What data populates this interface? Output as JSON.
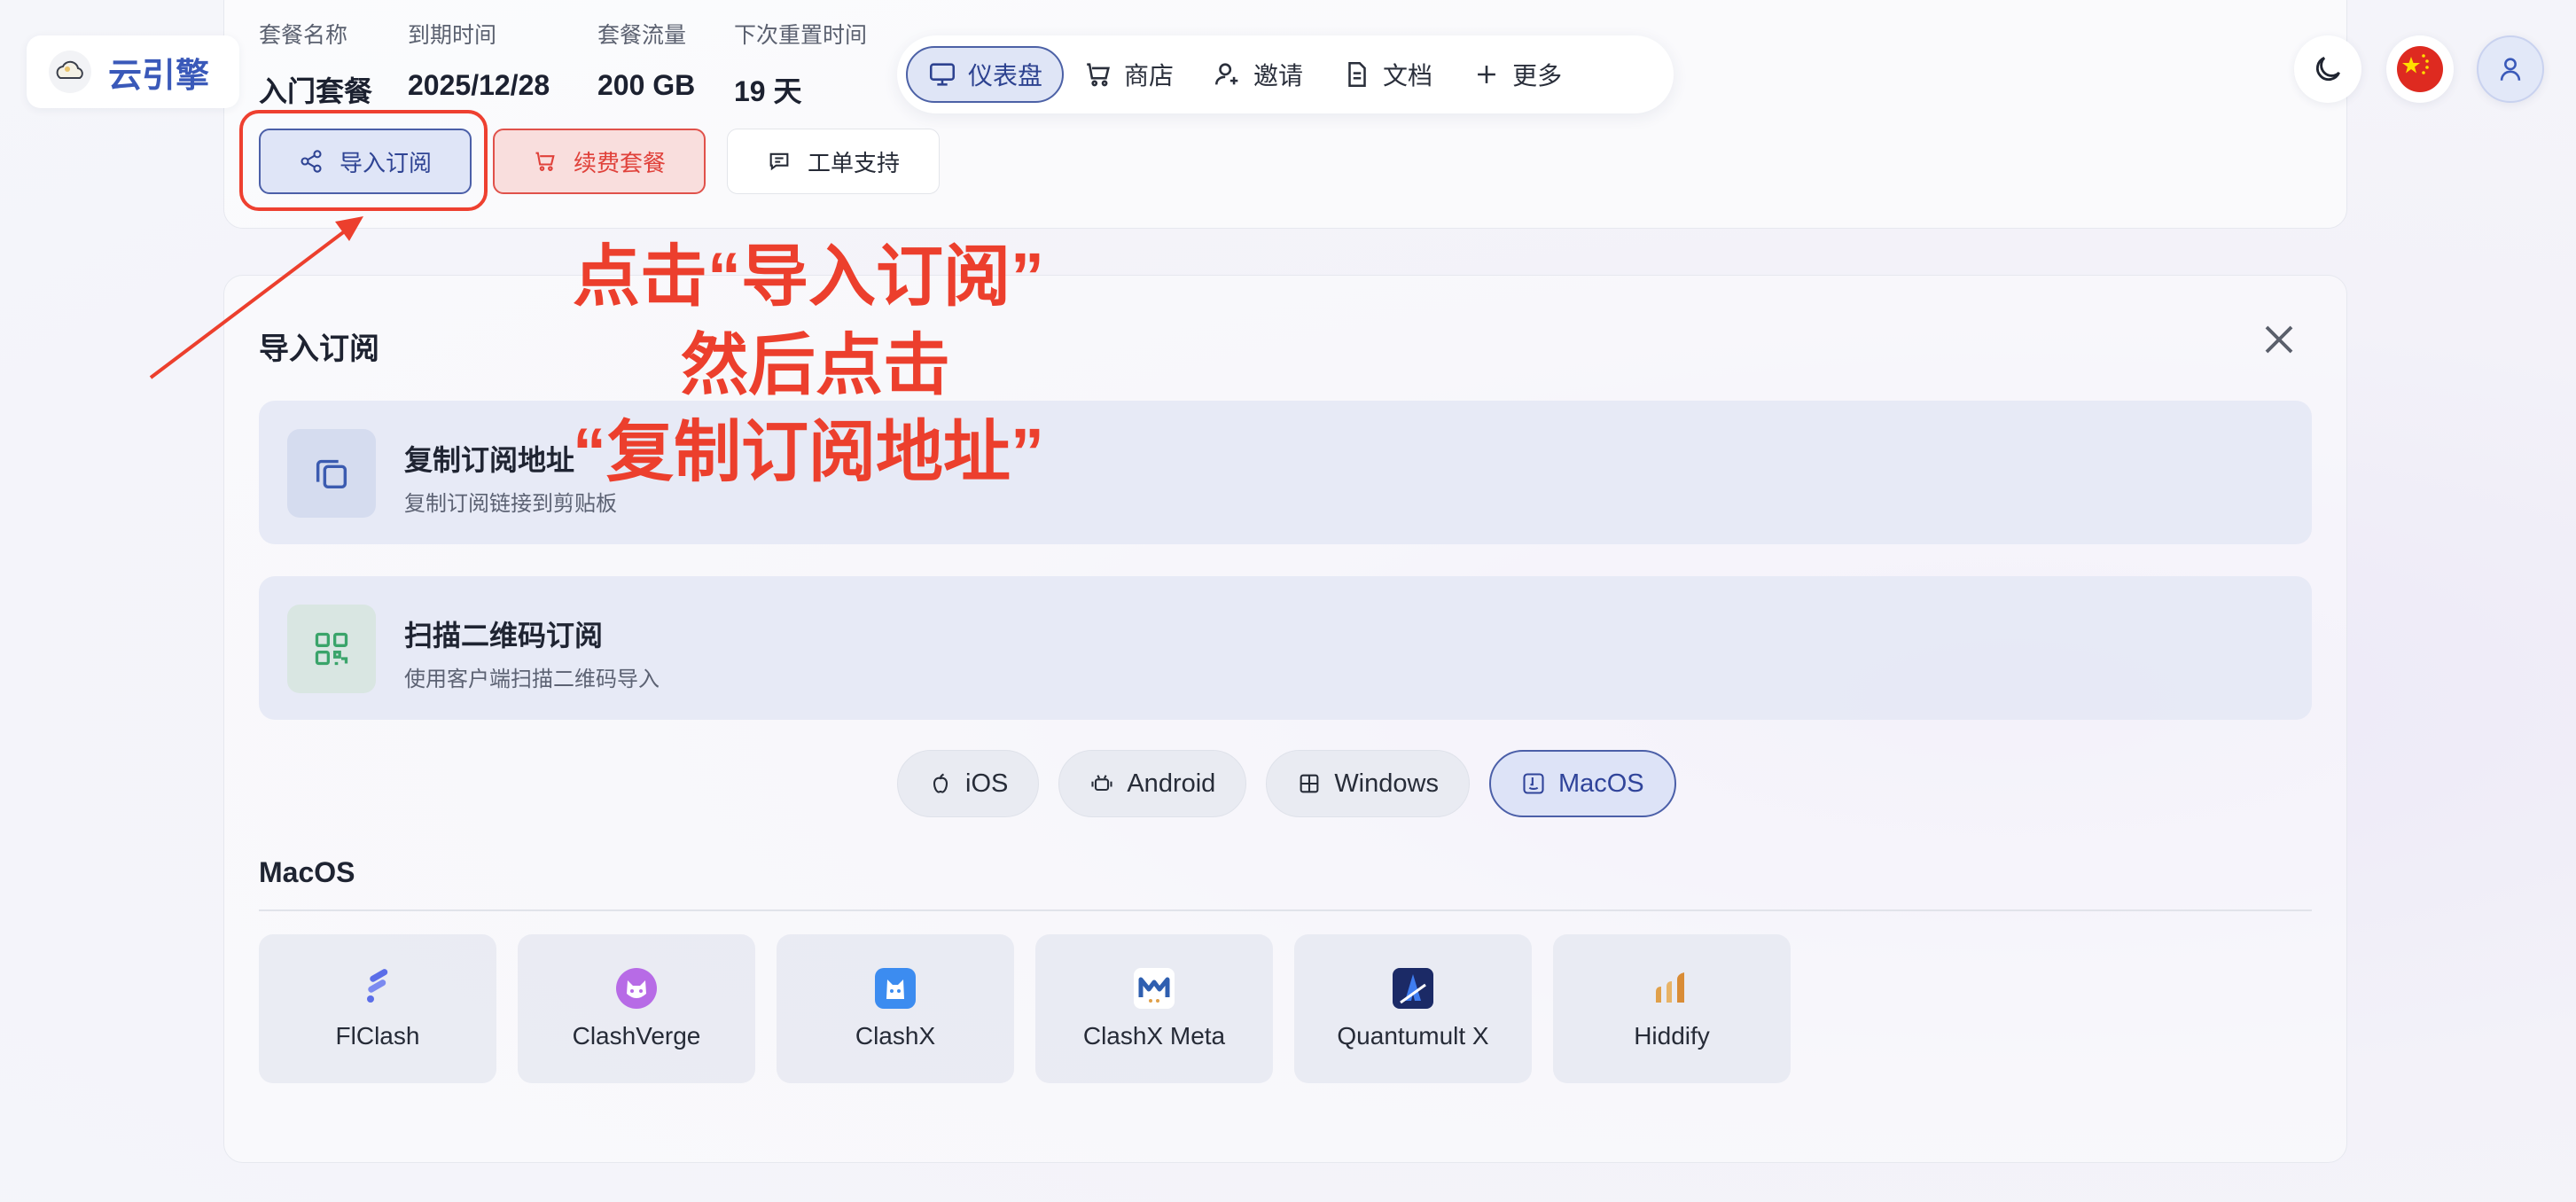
{
  "brand": {
    "name": "云引擎"
  },
  "stats": [
    {
      "label": "套餐名称",
      "value": "入门套餐"
    },
    {
      "label": "到期时间",
      "value": "2025/12/28"
    },
    {
      "label": "套餐流量",
      "value": "200 GB"
    },
    {
      "label": "下次重置时间",
      "value": "19 天"
    }
  ],
  "actions": {
    "import": "导入订阅",
    "renew": "续费套餐",
    "ticket": "工单支持"
  },
  "nav": [
    {
      "label": "仪表盘",
      "icon": "monitor-icon",
      "active": true
    },
    {
      "label": "商店",
      "icon": "cart-icon"
    },
    {
      "label": "邀请",
      "icon": "user-plus-icon"
    },
    {
      "label": "文档",
      "icon": "document-icon"
    },
    {
      "label": "更多",
      "icon": "plus-icon"
    }
  ],
  "import_panel": {
    "title": "导入订阅",
    "options": [
      {
        "title": "复制订阅地址",
        "subtitle": "复制订阅链接到剪贴板",
        "icon": "copy-icon"
      },
      {
        "title": "扫描二维码订阅",
        "subtitle": "使用客户端扫描二维码导入",
        "icon": "qrcode-icon"
      }
    ],
    "os_tabs": [
      {
        "label": "iOS",
        "icon": "apple-icon"
      },
      {
        "label": "Android",
        "icon": "android-icon"
      },
      {
        "label": "Windows",
        "icon": "windows-icon"
      },
      {
        "label": "MacOS",
        "icon": "macos-icon",
        "active": true
      }
    ],
    "section_title": "MacOS",
    "apps": [
      {
        "name": "FlClash",
        "icon": "flclash-icon",
        "color": "#5b6ee8"
      },
      {
        "name": "ClashVerge",
        "icon": "clashverge-icon",
        "color": "#b05be0"
      },
      {
        "name": "ClashX",
        "icon": "clashx-icon",
        "color": "#3c8cf0"
      },
      {
        "name": "ClashX Meta",
        "icon": "clashx-meta-icon",
        "color": "#2f5fb0"
      },
      {
        "name": "Quantumult X",
        "icon": "quantumultx-icon",
        "color": "#1b2a66"
      },
      {
        "name": "Hiddify",
        "icon": "hiddify-icon",
        "color": "#e0a04a"
      }
    ]
  },
  "annotation": {
    "line1": "点击“导入订阅”",
    "line2": "然后点击",
    "line3": "“复制订阅地址”",
    "color": "#ec3f2d"
  }
}
